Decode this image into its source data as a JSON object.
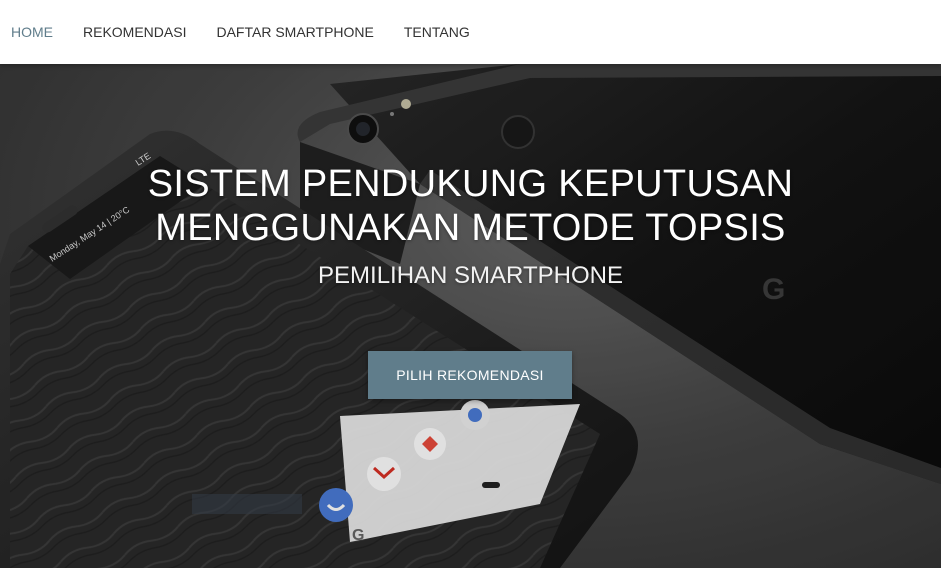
{
  "nav": {
    "items": [
      {
        "label": "HOME",
        "active": true
      },
      {
        "label": "REKOMENDASI",
        "active": false
      },
      {
        "label": "DAFTAR SMARTPHONE",
        "active": false
      },
      {
        "label": "TENTANG",
        "active": false
      }
    ]
  },
  "hero": {
    "title_line1": "SISTEM PENDUKUNG KEPUTUSAN",
    "title_line2": "MENGGUNAKAN METODE TOPSIS",
    "subtitle": "PEMILIHAN SMARTPHONE",
    "cta_label": "PILIH REKOMENDASI",
    "phone_status": "LTE",
    "phone_date": "Monday, May 14 | 20°C"
  },
  "colors": {
    "accent": "#607d8b",
    "nav_text": "#333333"
  }
}
